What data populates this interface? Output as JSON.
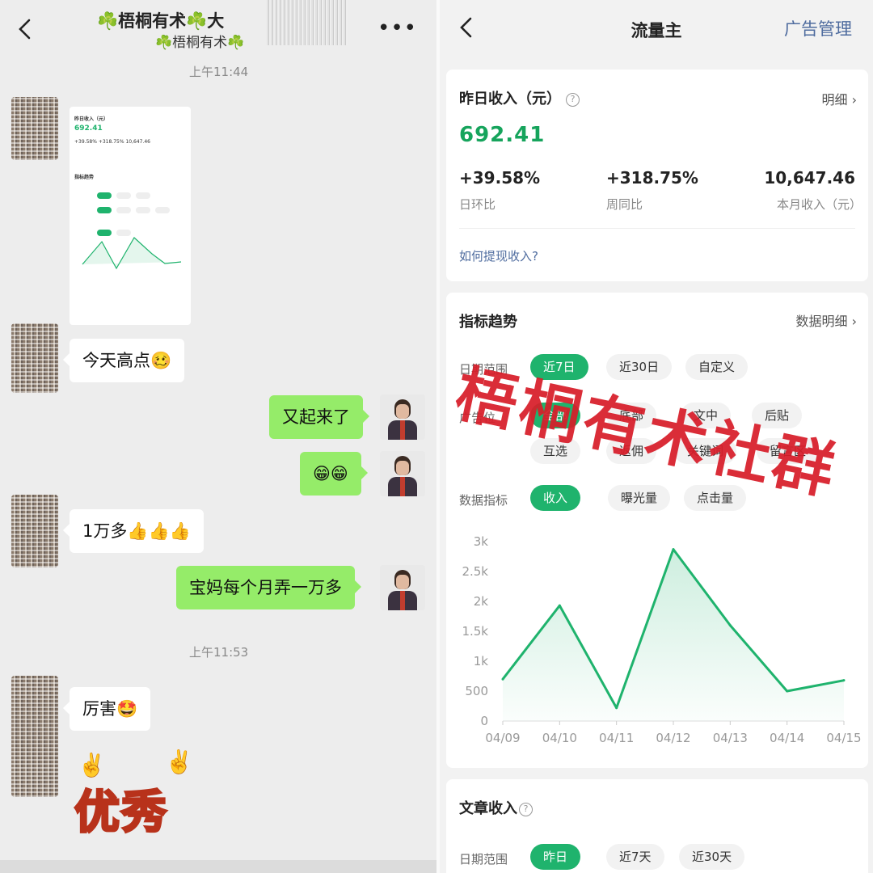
{
  "chat": {
    "title": "☘️梧桐有术☘️大",
    "subtitle": "☘️梧桐有术☘️",
    "more": "•••",
    "timestamps": [
      "上午11:44",
      "上午11:53"
    ],
    "thumbnail": {
      "title": "昨日收入（元）",
      "value": "692.41",
      "stats": "+39.58%   +318.75%   10,647.46",
      "section": "指标趋势"
    },
    "messages": [
      {
        "side": "in",
        "text": "今天高点🥴"
      },
      {
        "side": "out",
        "text": "又起来了"
      },
      {
        "side": "out",
        "text": "😁😁"
      },
      {
        "side": "in",
        "text": "1万多👍👍👍"
      },
      {
        "side": "out",
        "text": "宝妈每个月弄一万多"
      },
      {
        "side": "in",
        "text": "厉害🤩"
      }
    ],
    "sticker": {
      "text": "优秀",
      "hands": "✌️"
    }
  },
  "panel": {
    "title": "流量主",
    "admin_link": "广告管理",
    "income": {
      "title": "昨日收入（元）",
      "detail_link": "明细 ›",
      "value": "692.41",
      "stats": [
        {
          "value": "+39.58%",
          "label": "日环比"
        },
        {
          "value": "+318.75%",
          "label": "周同比"
        },
        {
          "value": "10,647.46",
          "label": "本月收入（元）"
        }
      ],
      "withdraw_link": "如何提现收入?"
    },
    "trend": {
      "title": "指标趋势",
      "detail_link": "数据明细 ›",
      "date_label": "日期范围",
      "date_chips": [
        "近7日",
        "近30日",
        "自定义"
      ],
      "ad_label": "广告位",
      "ad_chips_row1": [
        "全部",
        "底部",
        "文中",
        "后贴"
      ],
      "ad_chips_row2": [
        "互选",
        "返佣",
        "关键词",
        "留言区"
      ],
      "metric_label": "数据指标",
      "metric_chips": [
        "收入",
        "曝光量",
        "点击量"
      ]
    },
    "article": {
      "title": "文章收入",
      "date_label": "日期范围",
      "date_chips": [
        "昨日",
        "近7天",
        "近30天"
      ]
    }
  },
  "watermark": "梧桐有术社群",
  "colors": {
    "green": "#1fb36d",
    "bubble_out": "#95ec69",
    "link": "#4f6c9f",
    "watermark": "#d81e2a"
  },
  "chart_data": {
    "type": "line",
    "categories": [
      "04/09",
      "04/10",
      "04/11",
      "04/12",
      "04/13",
      "04/14",
      "04/15"
    ],
    "values": [
      700,
      1930,
      220,
      2870,
      1600,
      500,
      680
    ],
    "yticks": [
      "0",
      "500",
      "1k",
      "1.5k",
      "2k",
      "2.5k",
      "3k"
    ],
    "ylim": [
      0,
      3000
    ],
    "grid": false,
    "color": "#1fb36d"
  }
}
